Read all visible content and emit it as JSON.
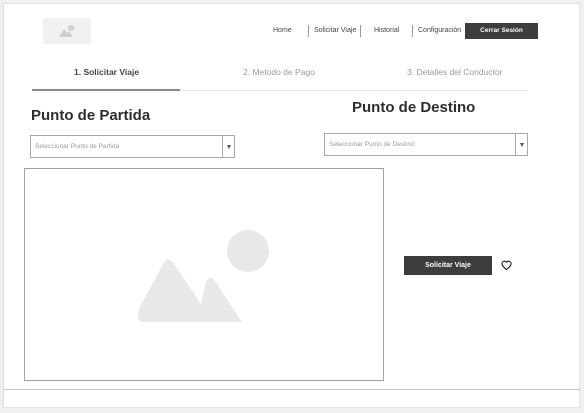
{
  "header": {
    "logo_icon": "image-placeholder-icon",
    "nav": [
      {
        "label": "Home"
      },
      {
        "label": "Solicitar Viaje"
      },
      {
        "label": "Historial"
      },
      {
        "label": "Configuración"
      }
    ],
    "logout_label": "Cerrar Sesión"
  },
  "steps": [
    {
      "label": "1. Solicitar Viaje",
      "active": true
    },
    {
      "label": "2. Metodo de Pago",
      "active": false
    },
    {
      "label": "3. Detalles del Conductor",
      "active": false
    }
  ],
  "origin": {
    "heading": "Punto de Partida",
    "placeholder": "Seleccionar Punto de Partida"
  },
  "destination": {
    "heading": "Punto de Destino",
    "placeholder": "Seleccionar Punto de Destino"
  },
  "map": {
    "icon": "image-placeholder-icon"
  },
  "actions": {
    "request_label": "Solicitar Viaje",
    "favorite_icon": "heart-icon"
  },
  "colors": {
    "primary_button": "#3d3d3d",
    "placeholder_gray": "#e8e8e8"
  }
}
